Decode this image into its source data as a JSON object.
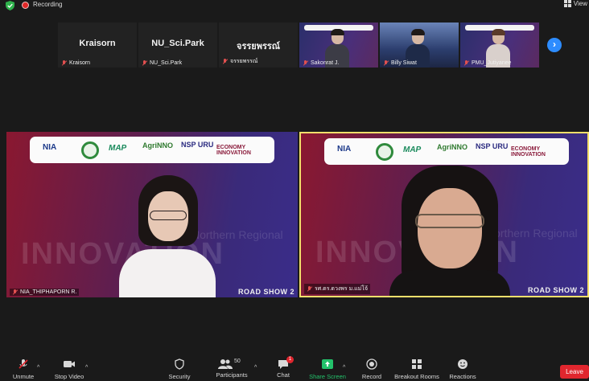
{
  "topbar": {
    "recording_label": "Recording",
    "view_label": "View"
  },
  "participants_strip": [
    {
      "display": "Kraisorn",
      "name": "Kraisorn",
      "video": false
    },
    {
      "display": "NU_Sci.Park",
      "name": "NU_Sci.Park",
      "video": false
    },
    {
      "display": "จรรยพรรณ์",
      "name": "จรรยพรรณ์",
      "video": false
    },
    {
      "display": "",
      "name": "Sakonrat J.",
      "video": true
    },
    {
      "display": "",
      "name": "Billy Siwat",
      "video": true
    },
    {
      "display": "",
      "name": "PMU_Jutiyanee",
      "video": true
    }
  ],
  "main_tiles": [
    {
      "name": "NIA_THIPHAPORN R.",
      "roadshow": "ROAD SHOW 2",
      "active": false
    },
    {
      "name": "รศ.ดร.ดวงพร ม.แม่โจ้",
      "roadshow": "ROAD SHOW 2",
      "active": true
    }
  ],
  "banner": {
    "nia": "NIA",
    "map": "MAP",
    "agri": "AgriNNO",
    "nsp": "NSP URU",
    "eco": "ECONOMY INNOVATION",
    "watermark": "INNOVATION",
    "watermark2": "Northern Regional"
  },
  "toolbar": {
    "unmute": "Unmute",
    "stop_video": "Stop Video",
    "security": "Security",
    "participants": "Participants",
    "participants_count": "50",
    "chat": "Chat",
    "chat_badge": "1",
    "share_screen": "Share Screen",
    "record": "Record",
    "breakout_rooms": "Breakout Rooms",
    "reactions": "Reactions",
    "leave": "Leave"
  },
  "colors": {
    "accent": "#2d8cff",
    "leave": "#e0262e",
    "active_border": "#f2df6b",
    "share": "#23c26b"
  }
}
